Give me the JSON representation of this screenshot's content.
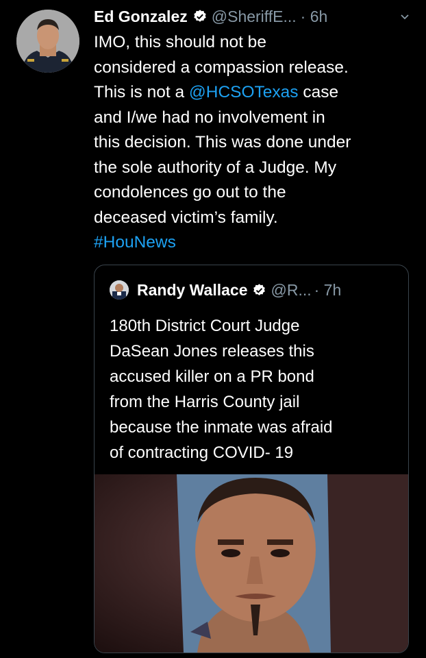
{
  "tweet": {
    "author_name": "Ed Gonzalez",
    "handle": "@SheriffE...",
    "time": "· 6h",
    "lines": [
      [
        {
          "t": "IMO, this should not be"
        }
      ],
      [
        {
          "t": "considered a compassion release."
        }
      ],
      [
        {
          "t": "This is not a "
        },
        {
          "t": "@HCSOTexas",
          "link": true
        },
        {
          "t": " case"
        }
      ],
      [
        {
          "t": "and I/we had no involvement in"
        }
      ],
      [
        {
          "t": "this decision. This was done under"
        }
      ],
      [
        {
          "t": "the sole authority of a Judge. My"
        }
      ],
      [
        {
          "t": "condolences go out to the"
        }
      ],
      [
        {
          "t": "deceased victim’s family."
        }
      ],
      [
        {
          "t": "#HouNews",
          "link": true
        }
      ]
    ]
  },
  "quoted_tweet": {
    "author_name": "Randy Wallace",
    "handle": "@R...",
    "time": "· 7h",
    "lines": [
      "180th District  Court Judge",
      "DaSean Jones releases this",
      "accused killer on a PR bond",
      "from the Harris County jail",
      "because the inmate was afraid",
      "of contracting COVID- 19"
    ]
  },
  "colors": {
    "background": "#000000",
    "text": "#ffffff",
    "secondary": "#8899a6",
    "link": "#1da1f2",
    "border": "#3a444c"
  },
  "icons": {
    "verified": "verified-badge-icon",
    "menu": "chevron-down-icon"
  }
}
